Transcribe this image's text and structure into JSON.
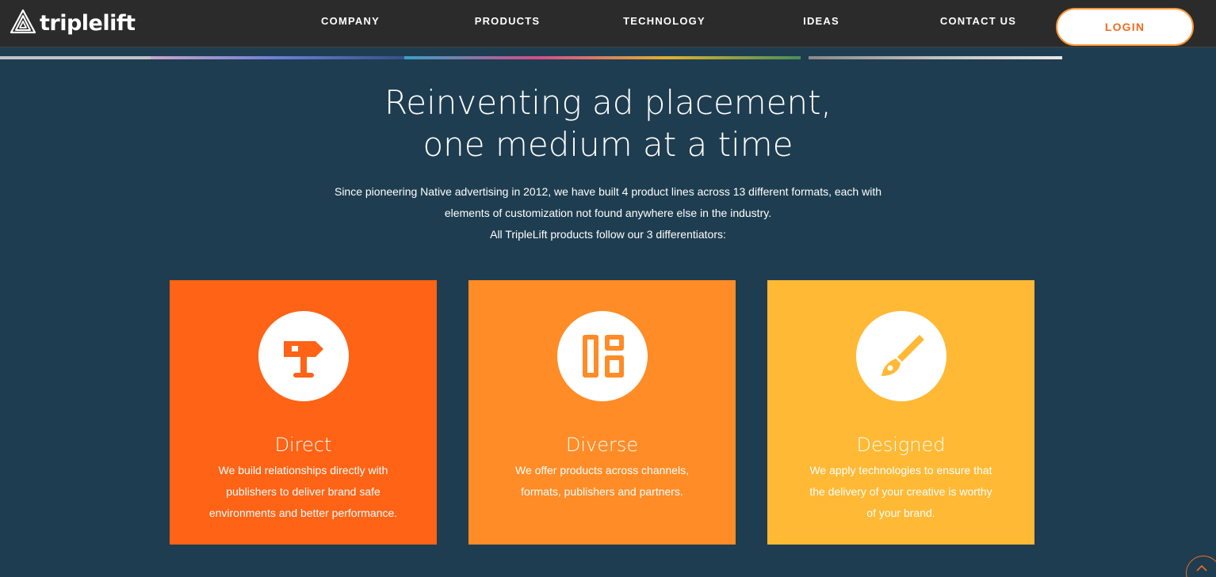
{
  "header": {
    "logo_text": "triplelift",
    "logo_icon": "triplelift-logo-icon",
    "nav": [
      {
        "label": "COMPANY"
      },
      {
        "label": "PRODUCTS"
      },
      {
        "label": "TECHNOLOGY"
      },
      {
        "label": "IDEAS"
      },
      {
        "label": "CONTACT US"
      }
    ],
    "login_label": "LOGIN"
  },
  "hero": {
    "headline_lines": [
      "Reinventing ad placement,",
      "one medium at a time"
    ],
    "subtext_lines": [
      "Since pioneering Native advertising in 2012, we have built 4 product lines across 13 different formats, each with",
      "elements of customization not found anywhere else in the industry.",
      "All TripleLift products follow our 3 differentiators:"
    ]
  },
  "cards": [
    {
      "title": "Direct",
      "icon": "signpost-icon",
      "color": "#ff6315",
      "text_lines": [
        "We build relationships directly with",
        "publishers to deliver brand safe",
        "environments and better performance."
      ]
    },
    {
      "title": "Diverse",
      "icon": "layout-grid-icon",
      "color": "#ff8c27",
      "text_lines": [
        "We offer products across channels,",
        "formats, publishers and partners."
      ]
    },
    {
      "title": "Designed",
      "icon": "paintbrush-icon",
      "color": "#ffb935",
      "text_lines": [
        "We apply technologies to ensure that",
        "the delivery of your creative is worthy",
        "of your brand."
      ]
    }
  ],
  "colors": {
    "header_bg": "#2b2b2b",
    "page_bg": "#1f3d50",
    "accent": "#f26b1d"
  },
  "scroll_top_icon": "chevron-up-icon"
}
